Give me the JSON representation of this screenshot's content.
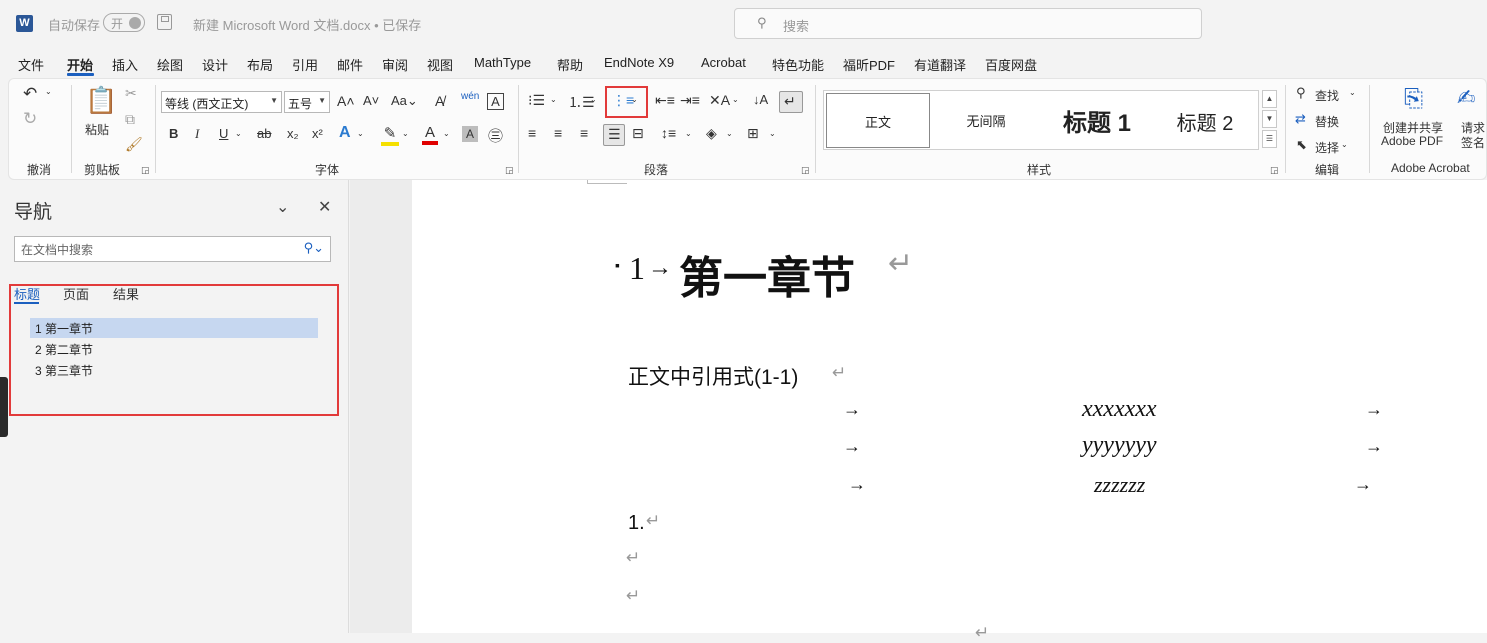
{
  "titlebar": {
    "app_icon": "word-logo-icon",
    "app_icon_letter": "W",
    "autosave_label": "自动保存",
    "autosave_state": "开",
    "doc_title": "新建 Microsoft Word 文档.docx • 已保存",
    "search_placeholder": "搜索"
  },
  "menu": {
    "items": [
      "文件",
      "开始",
      "插入",
      "绘图",
      "设计",
      "布局",
      "引用",
      "邮件",
      "审阅",
      "视图",
      "MathType",
      "帮助",
      "EndNote X9",
      "Acrobat",
      "特色功能",
      "福昕PDF",
      "有道翻译",
      "百度网盘"
    ],
    "active": "开始"
  },
  "ribbon": {
    "groups": {
      "undo": "撤消",
      "clipboard": "剪贴板",
      "font": "字体",
      "paragraph": "段落",
      "styles": "样式",
      "editing": "编辑",
      "acrobat": "Adobe Acrobat"
    },
    "paste_label": "粘贴",
    "font_name": "等线 (西文正文)",
    "font_size": "五号",
    "styles": [
      "正文",
      "无间隔",
      "标题 1",
      "标题 2"
    ],
    "find_label": "查找",
    "replace_label": "替换",
    "select_label": "选择",
    "acrobat_btn1_line1": "创建并共享",
    "acrobat_btn1_line2": "Adobe PDF",
    "acrobat_btn2_line1": "请求",
    "acrobat_btn2_line2": "签名"
  },
  "nav": {
    "title": "导航",
    "search_placeholder": "在文档中搜索",
    "tabs": [
      "标题",
      "页面",
      "结果"
    ],
    "active_tab": "标题",
    "headings": [
      "1 第一章节",
      "2 第二章节",
      "3 第三章节"
    ],
    "selected_heading": "1 第一章节"
  },
  "document": {
    "heading_number": "1",
    "heading_arrow": "→",
    "heading_text": "第一章节",
    "para_mark": "↵",
    "body_text": "正文中引用式(1-1)",
    "tab_arrow": "→",
    "equations": [
      "xxxxxxx",
      "yyyyyyy",
      "zzzzzz"
    ],
    "list_item": "1."
  }
}
